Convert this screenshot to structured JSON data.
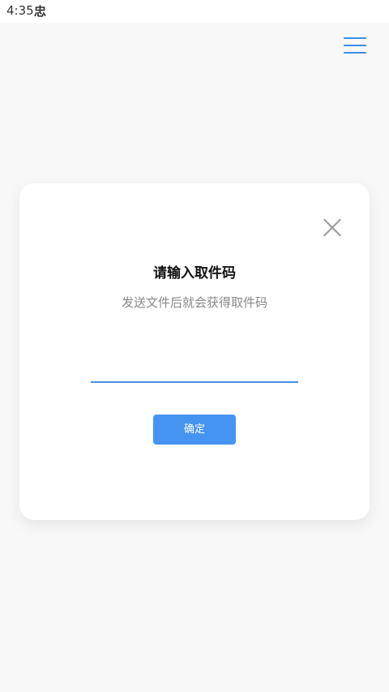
{
  "status_bar": {
    "time": "4:35",
    "icon_glyph": "忠"
  },
  "header": {
    "menu_icon": "hamburger-menu-icon",
    "accent_color": "#3b8ee8"
  },
  "dialog": {
    "title": "请输入取件码",
    "subtitle": "发送文件后就会获得取件码",
    "input": {
      "value": "",
      "placeholder": ""
    },
    "confirm_label": "确定",
    "close_icon": "close-icon",
    "button_color": "#4694f2"
  }
}
